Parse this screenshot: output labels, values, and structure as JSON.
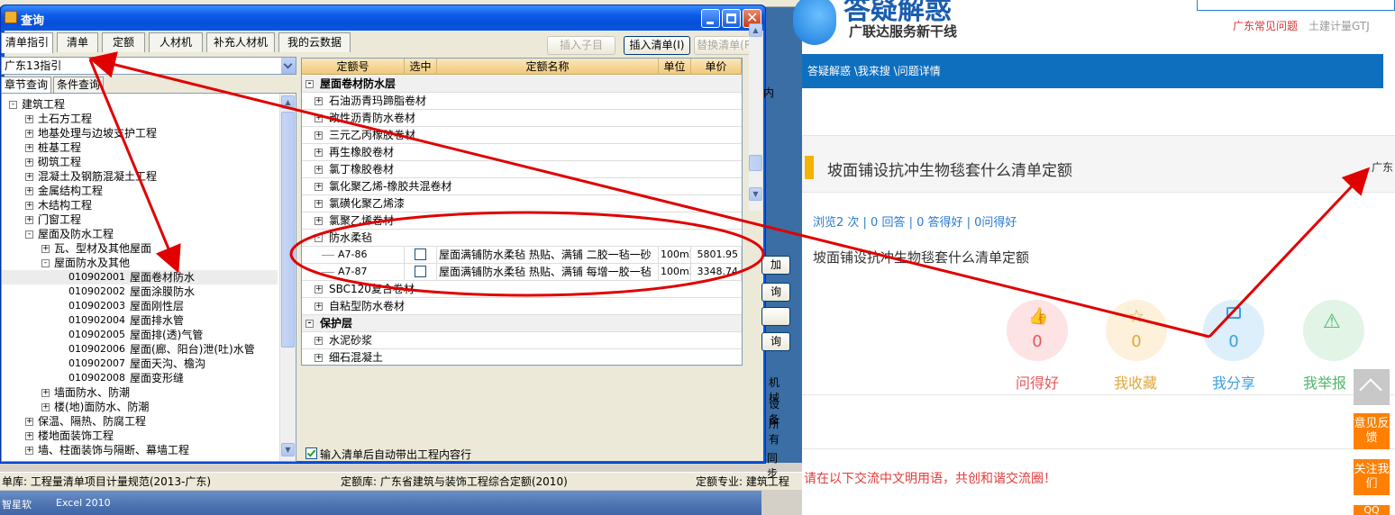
{
  "dialog": {
    "title": "查询",
    "tabs": [
      "清单指引",
      "清单",
      "定额",
      "人材机",
      "补充人材机",
      "我的云数据"
    ],
    "active_tab": "清单指引",
    "buttons": {
      "insert_child": "插入子目",
      "insert_list": "插入清单(I)",
      "replace_list": "替换清单(R)"
    },
    "guide_select": "广东13指引",
    "subtabs": [
      "章节查询",
      "条件查询"
    ],
    "tree": [
      {
        "label": "建筑工程",
        "level": 0,
        "expand": "-"
      },
      {
        "label": "土石方工程",
        "level": 1,
        "expand": "+"
      },
      {
        "label": "地基处理与边坡支护工程",
        "level": 1,
        "expand": "+"
      },
      {
        "label": "桩基工程",
        "level": 1,
        "expand": "+"
      },
      {
        "label": "砌筑工程",
        "level": 1,
        "expand": "+"
      },
      {
        "label": "混凝土及钢筋混凝土工程",
        "level": 1,
        "expand": "+"
      },
      {
        "label": "金属结构工程",
        "level": 1,
        "expand": "+"
      },
      {
        "label": "木结构工程",
        "level": 1,
        "expand": "+"
      },
      {
        "label": "门窗工程",
        "level": 1,
        "expand": "+"
      },
      {
        "label": "屋面及防水工程",
        "level": 1,
        "expand": "-"
      },
      {
        "label": "瓦、型材及其他屋面",
        "level": 2,
        "expand": "+"
      },
      {
        "label": "屋面防水及其他",
        "level": 2,
        "expand": "-"
      },
      {
        "code": "010902001",
        "label": "屋面卷材防水",
        "level": 3,
        "selected": true
      },
      {
        "code": "010902002",
        "label": "屋面涂膜防水",
        "level": 3
      },
      {
        "code": "010902003",
        "label": "屋面刚性层",
        "level": 3
      },
      {
        "code": "010902004",
        "label": "屋面排水管",
        "level": 3
      },
      {
        "code": "010902005",
        "label": "屋面排(透)气管",
        "level": 3
      },
      {
        "code": "010902006",
        "label": "屋面(廊、阳台)泄(吐)水管",
        "level": 3
      },
      {
        "code": "010902007",
        "label": "屋面天沟、檐沟",
        "level": 3
      },
      {
        "code": "010902008",
        "label": "屋面变形缝",
        "level": 3
      },
      {
        "label": "墙面防水、防潮",
        "level": 2,
        "expand": "+"
      },
      {
        "label": "楼(地)面防水、防潮",
        "level": 2,
        "expand": "+"
      },
      {
        "label": "保温、隔热、防腐工程",
        "level": 1,
        "expand": "+"
      },
      {
        "label": "楼地面装饰工程",
        "level": 1,
        "expand": "+"
      },
      {
        "label": "墙、柱面装饰与隔断、幕墙工程",
        "level": 1,
        "expand": "+"
      }
    ],
    "grid": {
      "headers": [
        "定额号",
        "选中",
        "定额名称",
        "单位",
        "单价"
      ],
      "rows": [
        {
          "type": "group",
          "label": "屋面卷材防水层",
          "expand": "-"
        },
        {
          "type": "sub",
          "label": "石油沥青玛蹄脂卷材",
          "expand": "+"
        },
        {
          "type": "sub",
          "label": "改性沥青防水卷材",
          "expand": "+"
        },
        {
          "type": "sub",
          "label": "三元乙丙橡胶卷材",
          "expand": "+"
        },
        {
          "type": "sub",
          "label": "再生橡胶卷材",
          "expand": "+"
        },
        {
          "type": "sub",
          "label": "氯丁橡胶卷材",
          "expand": "+"
        },
        {
          "type": "sub",
          "label": "氯化聚乙烯-橡胶共混卷材",
          "expand": "+"
        },
        {
          "type": "sub",
          "label": "氯磺化聚乙烯漆",
          "expand": "+"
        },
        {
          "type": "sub",
          "label": "氯聚乙烯卷材",
          "expand": "+"
        },
        {
          "type": "sub",
          "label": "防水柔毡",
          "expand": "-"
        },
        {
          "type": "item",
          "code": "A7-86",
          "name": "屋面满铺防水柔毡 热贴、满铺 二胶一毡一砂",
          "unit": "100m2",
          "price": "5801.95"
        },
        {
          "type": "item",
          "code": "A7-87",
          "name": "屋面满铺防水柔毡 热贴、满铺 每增一胶一毡",
          "unit": "100m2",
          "price": "3348.74"
        },
        {
          "type": "sub",
          "label": "SBC120复合卷材",
          "expand": "+"
        },
        {
          "type": "sub",
          "label": "自粘型防水卷材",
          "expand": "+"
        },
        {
          "type": "group",
          "label": "保护层",
          "expand": "-"
        },
        {
          "type": "sub",
          "label": "水泥砂浆",
          "expand": "+"
        },
        {
          "type": "sub",
          "label": "细石混凝土",
          "expand": "+"
        }
      ]
    },
    "auto_bring_checkbox": "输入清单后自动带出工程内容行",
    "right_fragments": [
      "加",
      "询",
      "询",
      "机械",
      "设备",
      "所有",
      "同步",
      "内"
    ]
  },
  "statusbar": {
    "list_lib": "单库: 工程量清单项目计量规范(2013-广东)",
    "quota_lib": "定额库: 广东省建筑与装饰工程综合定额(2010)",
    "quota_spec": "定额专业: 建筑工程"
  },
  "taskbar": {
    "items": [
      "智星软",
      "Excel 2010"
    ]
  },
  "web": {
    "logo_text": "答疑解惑",
    "slogan": "广联达服务新干线",
    "top_links": [
      "广东常见问题",
      "土建计量GTJ"
    ],
    "breadcrumb": "答疑解惑 \\我来搜 \\问题详情",
    "question_title": "坡面铺设抗冲生物毯套什么清单定额",
    "region": "广东",
    "stats": "浏览2 次 | 0 回答 | 0 答得好 | 0问得好",
    "question_body": "坡面铺设抗冲生物毯套什么清单定额",
    "actions": [
      {
        "label": "问得好",
        "count": "0",
        "color": "#e8585b",
        "bg": "#fde3e3"
      },
      {
        "label": "我收藏",
        "count": "0",
        "color": "#e0a83a",
        "bg": "#fdf1dc"
      },
      {
        "label": "我分享",
        "count": "0",
        "color": "#3a9ee0",
        "bg": "#dceffb"
      },
      {
        "label": "我举报",
        "count": "",
        "color": "#4fb66a",
        "bg": "#e1f4e5"
      }
    ],
    "notice": "请在以下交流中文明用语，共创和谐交流圈！",
    "side_buttons": [
      "意见反馈",
      "关注我们",
      "QQ"
    ]
  },
  "colors": {
    "annotation_red": "#e00000",
    "xp_blue": "#0a55e0",
    "web_blue": "#0f6fbf"
  }
}
